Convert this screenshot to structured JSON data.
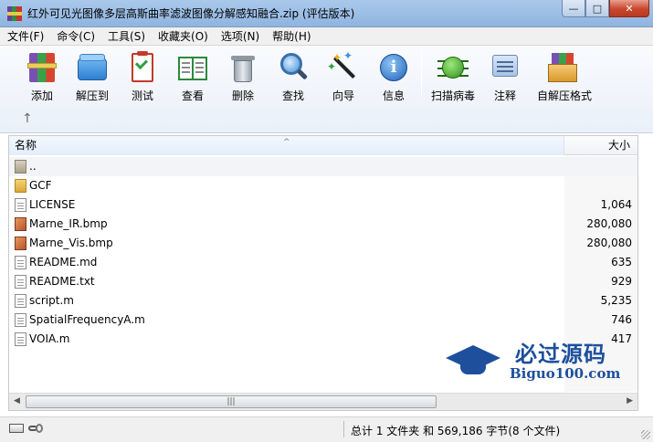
{
  "window": {
    "title": "红外可见光图像多层高斯曲率滤波图像分解感知融合.zip (评估版本)",
    "minimize": "—",
    "maximize": "□",
    "close": "✕"
  },
  "menu": [
    "文件(F)",
    "命令(C)",
    "工具(S)",
    "收藏夹(O)",
    "选项(N)",
    "帮助(H)"
  ],
  "toolbar": {
    "add": "添加",
    "extract": "解压到",
    "test": "测试",
    "view": "查看",
    "delete": "删除",
    "find": "查找",
    "wizard": "向导",
    "info": "信息",
    "scan": "扫描病毒",
    "comment": "注释",
    "sfx": "自解压格式",
    "up": "↑"
  },
  "list": {
    "col_name": "名称",
    "col_size": "大小",
    "sort_caret": "^",
    "files": [
      {
        "name": "..",
        "size": "",
        "type": "parent"
      },
      {
        "name": "GCF",
        "size": "",
        "type": "folder"
      },
      {
        "name": "LICENSE",
        "size": "1,064",
        "type": "doc"
      },
      {
        "name": "Marne_IR.bmp",
        "size": "280,080",
        "type": "bmp"
      },
      {
        "name": "Marne_Vis.bmp",
        "size": "280,080",
        "type": "bmp"
      },
      {
        "name": "README.md",
        "size": "635",
        "type": "doc"
      },
      {
        "name": "README.txt",
        "size": "929",
        "type": "doc"
      },
      {
        "name": "script.m",
        "size": "5,235",
        "type": "doc"
      },
      {
        "name": "SpatialFrequencyA.m",
        "size": "746",
        "type": "doc"
      },
      {
        "name": "VOIA.m",
        "size": "417",
        "type": "doc"
      }
    ],
    "scroll_left": "◀",
    "scroll_right": "▶",
    "scroll_grip": "|||"
  },
  "watermark": {
    "cn": "必过源码",
    "en": "Biguo100.com"
  },
  "status": {
    "summary": "总计 1 文件夹 和 569,186 字节(8 个文件)"
  },
  "colors": {
    "titlebar": "#9dbfe6",
    "accent": "#1d4f9c",
    "close": "#c9462c"
  }
}
